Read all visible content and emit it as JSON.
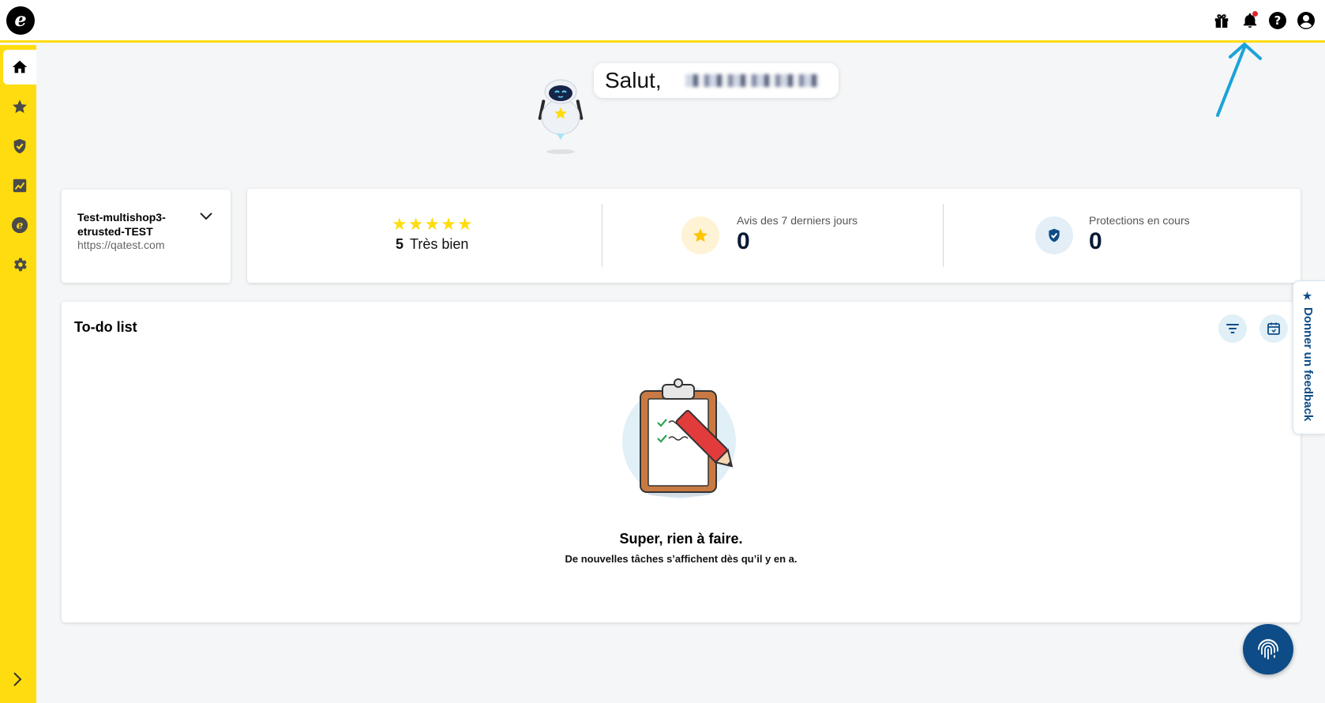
{
  "header": {
    "logo_letter": "e",
    "icons": [
      "gift-icon",
      "bell-icon",
      "help-icon",
      "account-icon"
    ],
    "help_glyph": "?",
    "notification_indicator_color": "#e0242b"
  },
  "sidebar": {
    "items": [
      {
        "name": "home-icon",
        "active": true
      },
      {
        "name": "star-icon",
        "active": false
      },
      {
        "name": "shield-check-icon",
        "active": false
      },
      {
        "name": "analytics-icon",
        "active": false
      },
      {
        "name": "etrusted-logo-icon",
        "active": false
      },
      {
        "name": "gear-icon",
        "active": false
      }
    ],
    "expand_icon": "chevron-right-icon",
    "accent_color": "#ffdc0f"
  },
  "greeting": {
    "text": "Salut,"
  },
  "shop_selector": {
    "name": "Test-multishop3-etrusted-TEST",
    "url": "https://qatest.com"
  },
  "stats": {
    "rating": {
      "stars": "★★★★★",
      "value": "5",
      "label": "Très bien"
    },
    "reviews": {
      "label": "Avis des 7 derniers jours",
      "value": "0"
    },
    "protections": {
      "label": "Protections en cours",
      "value": "0"
    }
  },
  "todo": {
    "title": "To-do list",
    "empty_title": "Super, rien à faire.",
    "empty_subtitle": "De nouvelles tâches s’affichent dès qu’il y en a."
  },
  "feedback": {
    "star": "★",
    "label": "Donner un feedback"
  },
  "colors": {
    "brand_yellow": "#ffdc0f",
    "brand_blue": "#0e4c87",
    "annotation_arrow": "#1aa3d9"
  }
}
